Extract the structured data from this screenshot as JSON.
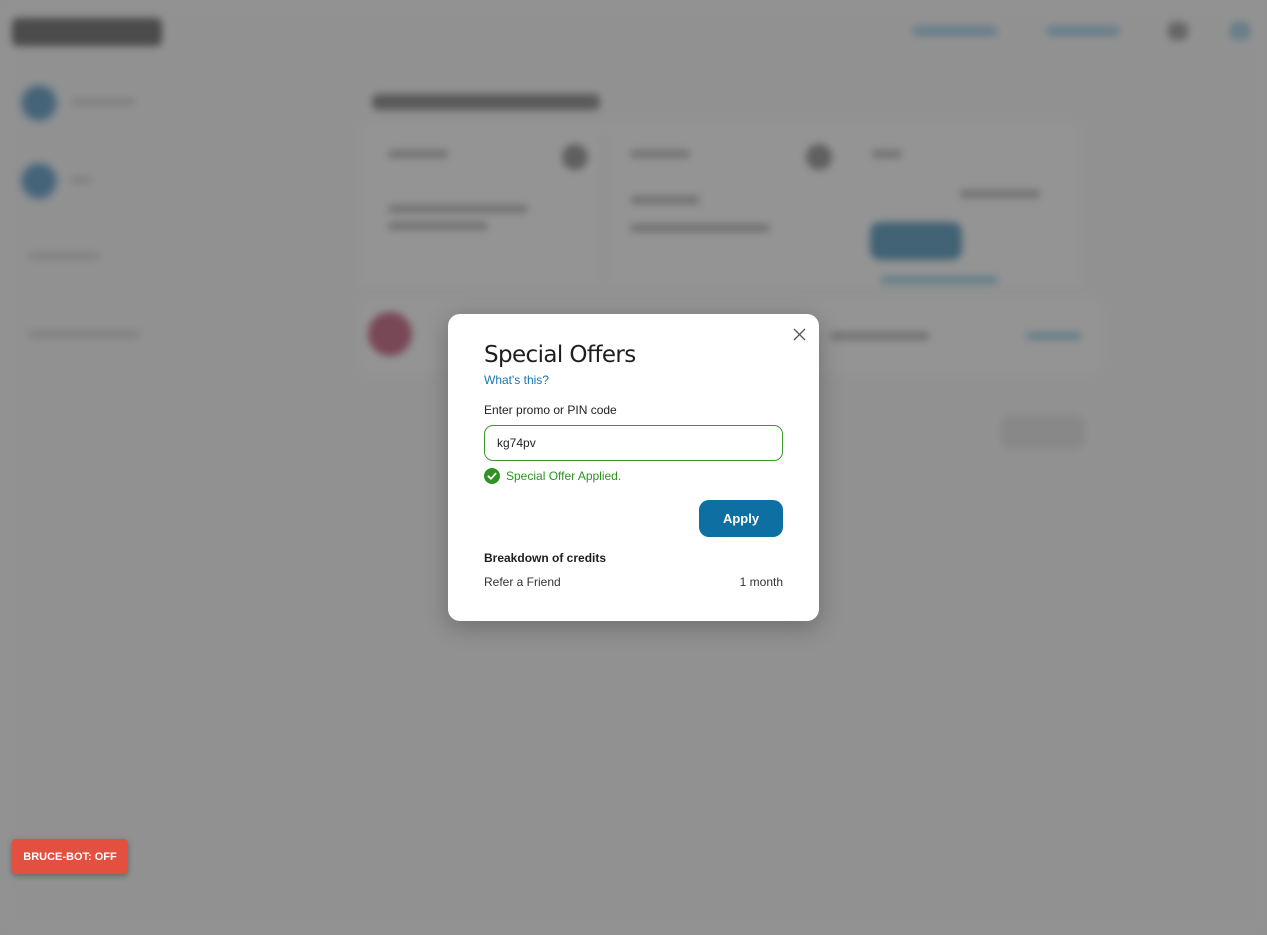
{
  "modal": {
    "title": "Special Offers",
    "help_link": "What's this?",
    "input_label": "Enter promo or PIN code",
    "input_value": "kg74pv",
    "success_message": "Special Offer Applied.",
    "apply_label": "Apply",
    "breakdown_heading": "Breakdown of credits",
    "credits": [
      {
        "label": "Refer a Friend",
        "value": "1 month"
      }
    ],
    "icons": {
      "close": "close-icon",
      "success": "check-circle-icon"
    }
  },
  "bot_toggle": {
    "label": "BRUCE-BOT: OFF",
    "color": "#e3503f"
  },
  "colors": {
    "accent": "#0e6fa3",
    "link": "#1477b0",
    "success": "#2e9322"
  }
}
